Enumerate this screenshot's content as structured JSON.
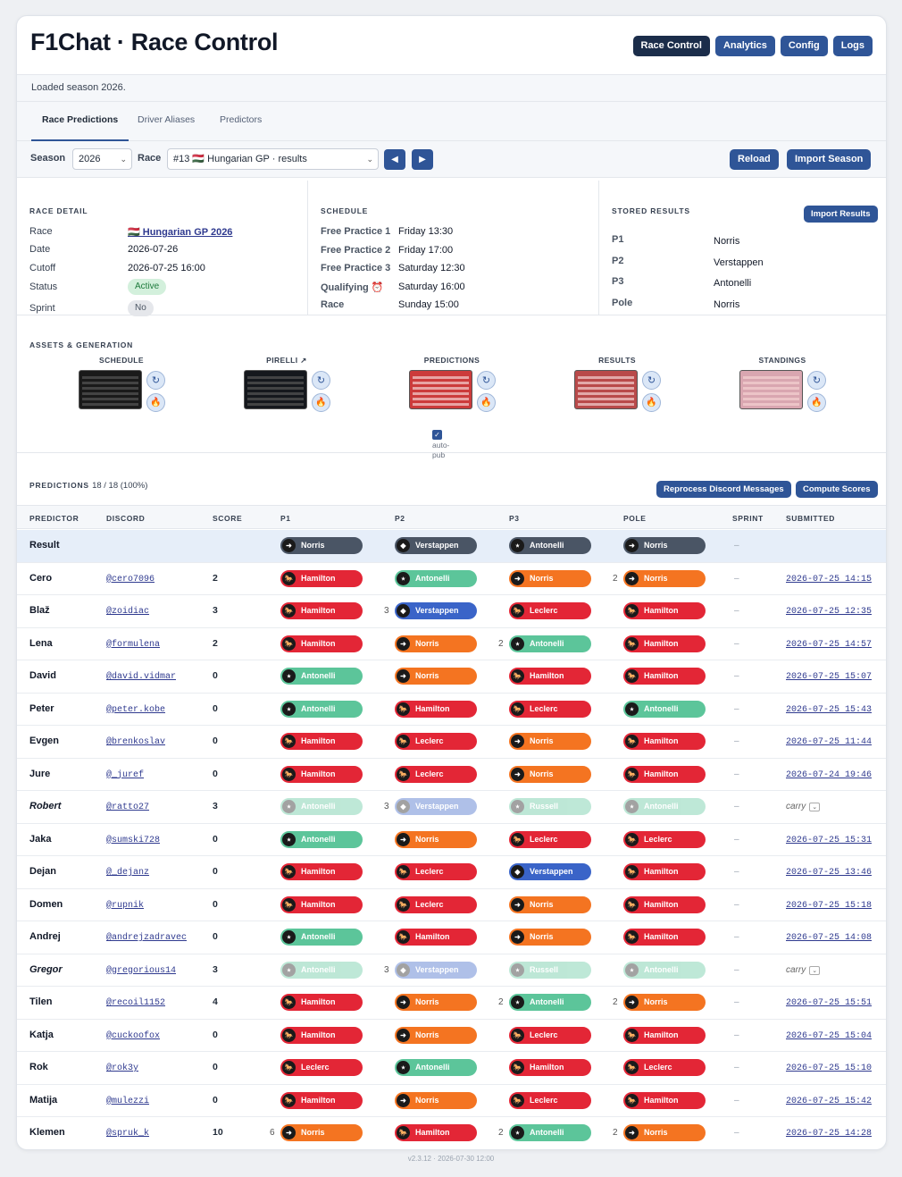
{
  "app_title": "F1Chat · Race Control",
  "nav": [
    "Race Control",
    "Analytics",
    "Config",
    "Logs"
  ],
  "message": "Loaded season 2026.",
  "tabs": [
    "Race Predictions",
    "Driver Aliases",
    "Predictors"
  ],
  "controls": {
    "season_label": "Season",
    "season_value": "2026",
    "race_label": "Race",
    "race_value": "#13 🇭🇺 Hungarian GP · results",
    "prev": "◀",
    "next": "▶",
    "reload": "Reload",
    "import_season": "Import Season"
  },
  "race_detail": {
    "heading": "RACE DETAIL",
    "rows": [
      {
        "k": "Race",
        "v": "🇭🇺 Hungarian GP 2026"
      },
      {
        "k": "Date",
        "v": "2026-07-26"
      },
      {
        "k": "Cutoff",
        "v": "2026-07-25 16:00"
      },
      {
        "k": "Status",
        "v": "Active"
      },
      {
        "k": "Sprint",
        "v": "No"
      }
    ]
  },
  "schedule": {
    "heading": "SCHEDULE",
    "rows": [
      {
        "k": "Free Practice 1",
        "v": "Friday 13:30"
      },
      {
        "k": "Free Practice 2",
        "v": "Friday 17:00"
      },
      {
        "k": "Free Practice 3",
        "v": "Saturday 12:30"
      },
      {
        "k": "Qualifying ⏰",
        "v": "Saturday 16:00"
      },
      {
        "k": "Race",
        "v": "Sunday 15:00"
      }
    ]
  },
  "stored_results": {
    "heading": "STORED RESULTS",
    "button": "Import Results",
    "rows": [
      {
        "k": "P1",
        "v": "Norris"
      },
      {
        "k": "P2",
        "v": "Verstappen"
      },
      {
        "k": "P3",
        "v": "Antonelli"
      },
      {
        "k": "Pole",
        "v": "Norris"
      }
    ]
  },
  "assets": {
    "heading": "ASSETS & GENERATION",
    "items": [
      "SCHEDULE",
      "PIRELLI ↗",
      "PREDICTIONS",
      "RESULTS",
      "STANDINGS"
    ],
    "autopub": "auto-pub",
    "regen": "↻",
    "flame": "🔥"
  },
  "predictions": {
    "heading": "PREDICTIONS",
    "count": "18 / 18 (100%)",
    "reprocess": "Reprocess Discord Messages",
    "compute": "Compute Scores",
    "columns": [
      "PREDICTOR",
      "DISCORD",
      "SCORE",
      "P1",
      "P2",
      "P3",
      "POLE",
      "SPRINT",
      "SUBMITTED"
    ],
    "result_label": "Result",
    "result": [
      "Norris",
      "Verstappen",
      "Antonelli",
      "Norris"
    ],
    "rows": [
      {
        "n": "Cero",
        "d": "@cero7096",
        "s": "2",
        "p": [
          "Hamilton",
          "Antonelli",
          "Norris",
          "Norris"
        ],
        "pts": [
          "",
          "",
          "",
          "2"
        ],
        "t": "2026-07-25 14:15"
      },
      {
        "n": "Blaž",
        "d": "@zoidiac",
        "s": "3",
        "p": [
          "Hamilton",
          "Verstappen",
          "Leclerc",
          "Hamilton"
        ],
        "pts": [
          "",
          "3",
          "",
          ""
        ],
        "t": "2026-07-25 12:35"
      },
      {
        "n": "Lena",
        "d": "@formulena",
        "s": "2",
        "p": [
          "Hamilton",
          "Norris",
          "Antonelli",
          "Hamilton"
        ],
        "pts": [
          "",
          "",
          "2",
          ""
        ],
        "t": "2026-07-25 14:57"
      },
      {
        "n": "David",
        "d": "@david.vidmar",
        "s": "0",
        "p": [
          "Antonelli",
          "Norris",
          "Hamilton",
          "Hamilton"
        ],
        "pts": [
          "",
          "",
          "",
          ""
        ],
        "t": "2026-07-25 15:07"
      },
      {
        "n": "Peter",
        "d": "@peter.kobe",
        "s": "0",
        "p": [
          "Antonelli",
          "Hamilton",
          "Leclerc",
          "Antonelli"
        ],
        "pts": [
          "",
          "",
          "",
          ""
        ],
        "t": "2026-07-25 15:43"
      },
      {
        "n": "Evgen",
        "d": "@brenkoslav",
        "s": "0",
        "p": [
          "Hamilton",
          "Leclerc",
          "Norris",
          "Hamilton"
        ],
        "pts": [
          "",
          "",
          "",
          ""
        ],
        "t": "2026-07-25 11:44"
      },
      {
        "n": "Jure",
        "d": "@_juref",
        "s": "0",
        "p": [
          "Hamilton",
          "Leclerc",
          "Norris",
          "Hamilton"
        ],
        "pts": [
          "",
          "",
          "",
          ""
        ],
        "t": "2026-07-24 19:46"
      },
      {
        "n": "Robert",
        "d": "@ratto27",
        "s": "3",
        "p": [
          "Antonelli",
          "Verstappen",
          "Russell",
          "Antonelli"
        ],
        "pts": [
          "",
          "3",
          "",
          ""
        ],
        "t": "carry",
        "faded": true
      },
      {
        "n": "Jaka",
        "d": "@sumski728",
        "s": "0",
        "p": [
          "Antonelli",
          "Norris",
          "Leclerc",
          "Leclerc"
        ],
        "pts": [
          "",
          "",
          "",
          ""
        ],
        "t": "2026-07-25 15:31"
      },
      {
        "n": "Dejan",
        "d": "@_dejanz",
        "s": "0",
        "p": [
          "Hamilton",
          "Leclerc",
          "Verstappen",
          "Hamilton"
        ],
        "pts": [
          "",
          "",
          "",
          ""
        ],
        "t": "2026-07-25 13:46"
      },
      {
        "n": "Domen",
        "d": "@rupnik",
        "s": "0",
        "p": [
          "Hamilton",
          "Leclerc",
          "Norris",
          "Hamilton"
        ],
        "pts": [
          "",
          "",
          "",
          ""
        ],
        "t": "2026-07-25 15:18"
      },
      {
        "n": "Andrej",
        "d": "@andrejzadravec",
        "s": "0",
        "p": [
          "Antonelli",
          "Hamilton",
          "Norris",
          "Hamilton"
        ],
        "pts": [
          "",
          "",
          "",
          ""
        ],
        "t": "2026-07-25 14:08"
      },
      {
        "n": "Gregor",
        "d": "@gregorious14",
        "s": "3",
        "p": [
          "Antonelli",
          "Verstappen",
          "Russell",
          "Antonelli"
        ],
        "pts": [
          "",
          "3",
          "",
          ""
        ],
        "t": "carry",
        "faded": true
      },
      {
        "n": "Tilen",
        "d": "@recoil1152",
        "s": "4",
        "p": [
          "Hamilton",
          "Norris",
          "Antonelli",
          "Norris"
        ],
        "pts": [
          "",
          "",
          "2",
          "2"
        ],
        "t": "2026-07-25 15:51"
      },
      {
        "n": "Katja",
        "d": "@cuckoofox",
        "s": "0",
        "p": [
          "Hamilton",
          "Norris",
          "Leclerc",
          "Hamilton"
        ],
        "pts": [
          "",
          "",
          "",
          ""
        ],
        "t": "2026-07-25 15:04"
      },
      {
        "n": "Rok",
        "d": "@rok3y",
        "s": "0",
        "p": [
          "Leclerc",
          "Antonelli",
          "Hamilton",
          "Leclerc"
        ],
        "pts": [
          "",
          "",
          "",
          ""
        ],
        "t": "2026-07-25 15:10"
      },
      {
        "n": "Matija",
        "d": "@mulezzi",
        "s": "0",
        "p": [
          "Hamilton",
          "Norris",
          "Leclerc",
          "Hamilton"
        ],
        "pts": [
          "",
          "",
          "",
          ""
        ],
        "t": "2026-07-25 15:42"
      },
      {
        "n": "Klemen",
        "d": "@spruk_k",
        "s": "10",
        "p": [
          "Norris",
          "Hamilton",
          "Antonelli",
          "Norris"
        ],
        "pts": [
          "6",
          "",
          "2",
          "2"
        ],
        "t": "2026-07-25 14:28"
      }
    ],
    "sprint_dash": "–"
  },
  "team_colors": {
    "Hamilton": "#e32636",
    "Leclerc": "#e32636",
    "Norris": "#f47421",
    "Antonelli": "#5cc59a",
    "Russell": "#5cc59a",
    "Verstappen": "#3a64c8"
  },
  "result_color": "#4a5565",
  "footer": "v2.3.12 · 2026-07-30 12:00"
}
